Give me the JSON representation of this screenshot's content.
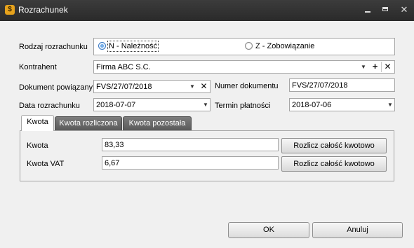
{
  "window": {
    "title": "Rozrachunek",
    "app_icon": "money-bag-icon",
    "controls": {
      "minimize": "minimize-icon",
      "maximize": "maximize-icon",
      "close": "close-icon"
    }
  },
  "form": {
    "rodzaj": {
      "label": "Rodzaj rozrachunku",
      "options": [
        "N - Należność",
        "Z - Zobowiązanie"
      ],
      "selected": "N - Należność"
    },
    "kontrahent": {
      "label": "Kontrahent",
      "value": "Firma ABC S.C."
    },
    "dokument_powiazany": {
      "label": "Dokument powiązany",
      "value": "FVS/27/07/2018"
    },
    "numer_dokumentu": {
      "label": "Numer dokumentu",
      "value": "FVS/27/07/2018"
    },
    "data_rozrachunku": {
      "label": "Data rozrachunku",
      "value": "2018-07-07"
    },
    "termin_platnosci": {
      "label": "Termin płatności",
      "value": "2018-07-06"
    }
  },
  "tabs": [
    {
      "label": "Kwota",
      "active": true
    },
    {
      "label": "Kwota rozliczona",
      "active": false
    },
    {
      "label": "Kwota pozostała",
      "active": false
    }
  ],
  "kwota_panel": {
    "kwota": {
      "label": "Kwota",
      "value": "83,33",
      "button": "Rozlicz całość kwotowo"
    },
    "kwota_vat": {
      "label": "Kwota VAT",
      "value": "6,67",
      "button": "Rozlicz całość kwotowo"
    }
  },
  "footer": {
    "ok": "OK",
    "cancel": "Anuluj"
  }
}
